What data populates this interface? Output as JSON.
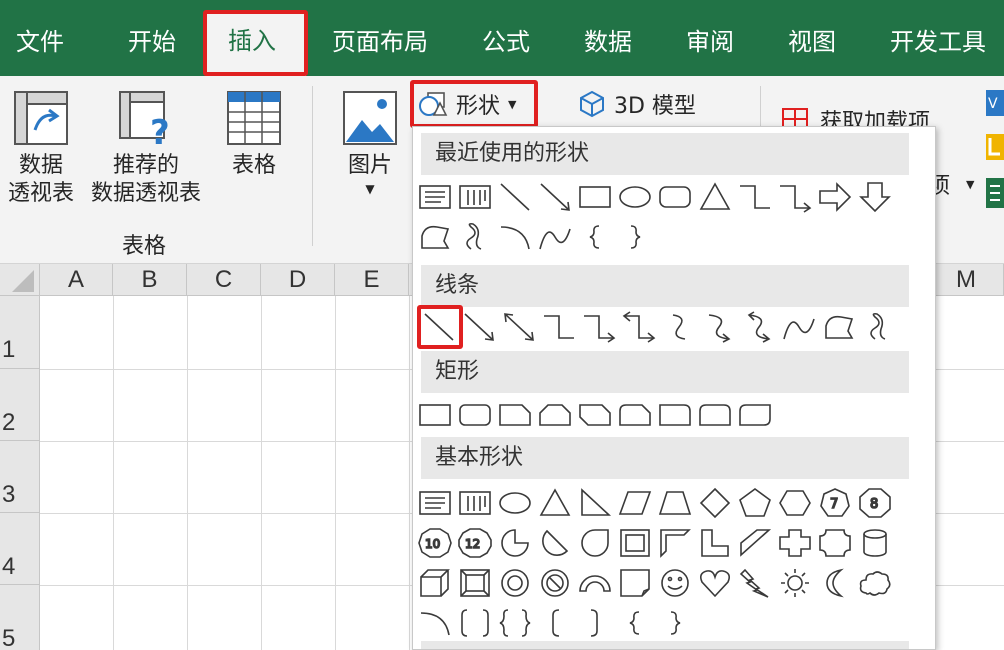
{
  "tabs": [
    "文件",
    "开始",
    "插入",
    "页面布局",
    "公式",
    "数据",
    "审阅",
    "视图",
    "开发工具"
  ],
  "active_tab": "插入",
  "ribbon": {
    "pivot_table": [
      "数据",
      "透视表"
    ],
    "recommended_pivot": [
      "推荐的",
      "数据透视表"
    ],
    "table": "表格",
    "tables_group": "表格",
    "picture": "图片",
    "shapes": "形状",
    "model_3d": "3D 模型",
    "get_addins": "获取加载项",
    "partial_label": "项"
  },
  "sheet": {
    "columns": [
      "A",
      "B",
      "C",
      "D",
      "E",
      "M"
    ],
    "rows": [
      "1",
      "2",
      "3",
      "4",
      "5"
    ]
  },
  "shapes_menu": {
    "sections": [
      "最近使用的形状",
      "线条",
      "矩形",
      "基本形状"
    ],
    "recent_shapes": [
      "text-box",
      "vertical-text-box",
      "line",
      "line-arrow",
      "rectangle",
      "oval",
      "rounded-rectangle",
      "triangle",
      "elbow-connector",
      "elbow-arrow-connector",
      "right-arrow",
      "down-arrow",
      "freeform-shape",
      "scribble",
      "arc",
      "curve",
      "left-brace",
      "right-brace"
    ],
    "lines": [
      "line",
      "line-arrow",
      "double-arrow-line",
      "elbow-connector",
      "elbow-arrow-connector",
      "elbow-double-arrow-connector",
      "curved-connector",
      "curved-arrow-connector",
      "curved-double-arrow-connector",
      "curve",
      "freeform-shape",
      "scribble"
    ],
    "rectangles": [
      "rectangle",
      "rounded-rectangle",
      "snip-single-corner",
      "snip-same-side",
      "snip-diagonal",
      "snip-round-single",
      "round-single-corner",
      "round-same-side",
      "round-diagonal"
    ],
    "basic_shapes_labels": {
      "heptagon": "7",
      "octagon": "8",
      "decagon": "10",
      "dodecagon": "12"
    }
  },
  "colors": {
    "excel_green": "#217346",
    "highlight_red": "#e02020",
    "ribbon_bg": "#f3f3f3"
  }
}
